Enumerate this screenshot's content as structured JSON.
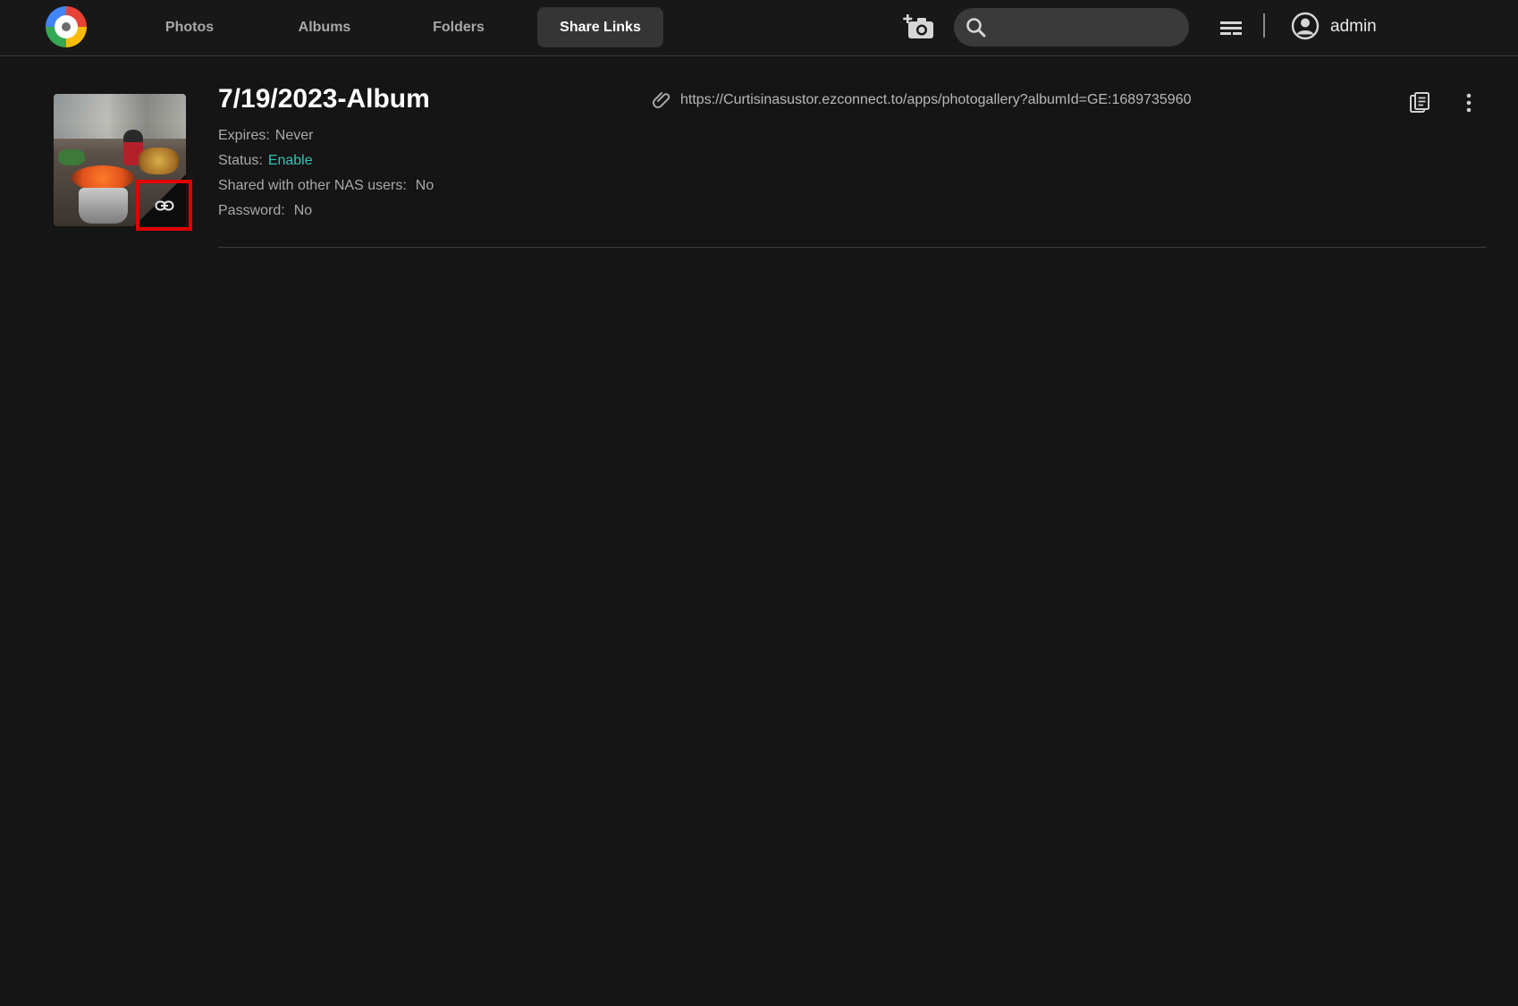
{
  "nav": {
    "tabs": [
      {
        "label": "Photos",
        "active": false
      },
      {
        "label": "Albums",
        "active": false
      },
      {
        "label": "Folders",
        "active": false
      },
      {
        "label": "Share Links",
        "active": true
      }
    ]
  },
  "header": {
    "search_placeholder": "",
    "user_name": "admin"
  },
  "share_link": {
    "title": "7/19/2023-Album",
    "expires_label": "Expires:",
    "expires_value": "Never",
    "status_label": "Status:",
    "status_value": "Enable",
    "shared_label": "Shared with other NAS users:",
    "shared_value": "No",
    "password_label": "Password:",
    "password_value": "No",
    "url": "https://Curtisinasustor.ezconnect.to/apps/photogallery?albumId=GE:1689735960"
  },
  "colors": {
    "accent_teal": "#2ec4b6",
    "highlight_red": "#e00000",
    "background": "#151515"
  },
  "icons": {
    "logo": "photo-gallery-logo",
    "camera": "add-photo-camera-icon",
    "search": "search-icon",
    "menu": "list-menu-icon",
    "user": "user-avatar-icon",
    "link": "link-icon",
    "paperclip": "paperclip-icon",
    "copy": "copy-icon",
    "more": "more-vertical-icon"
  }
}
